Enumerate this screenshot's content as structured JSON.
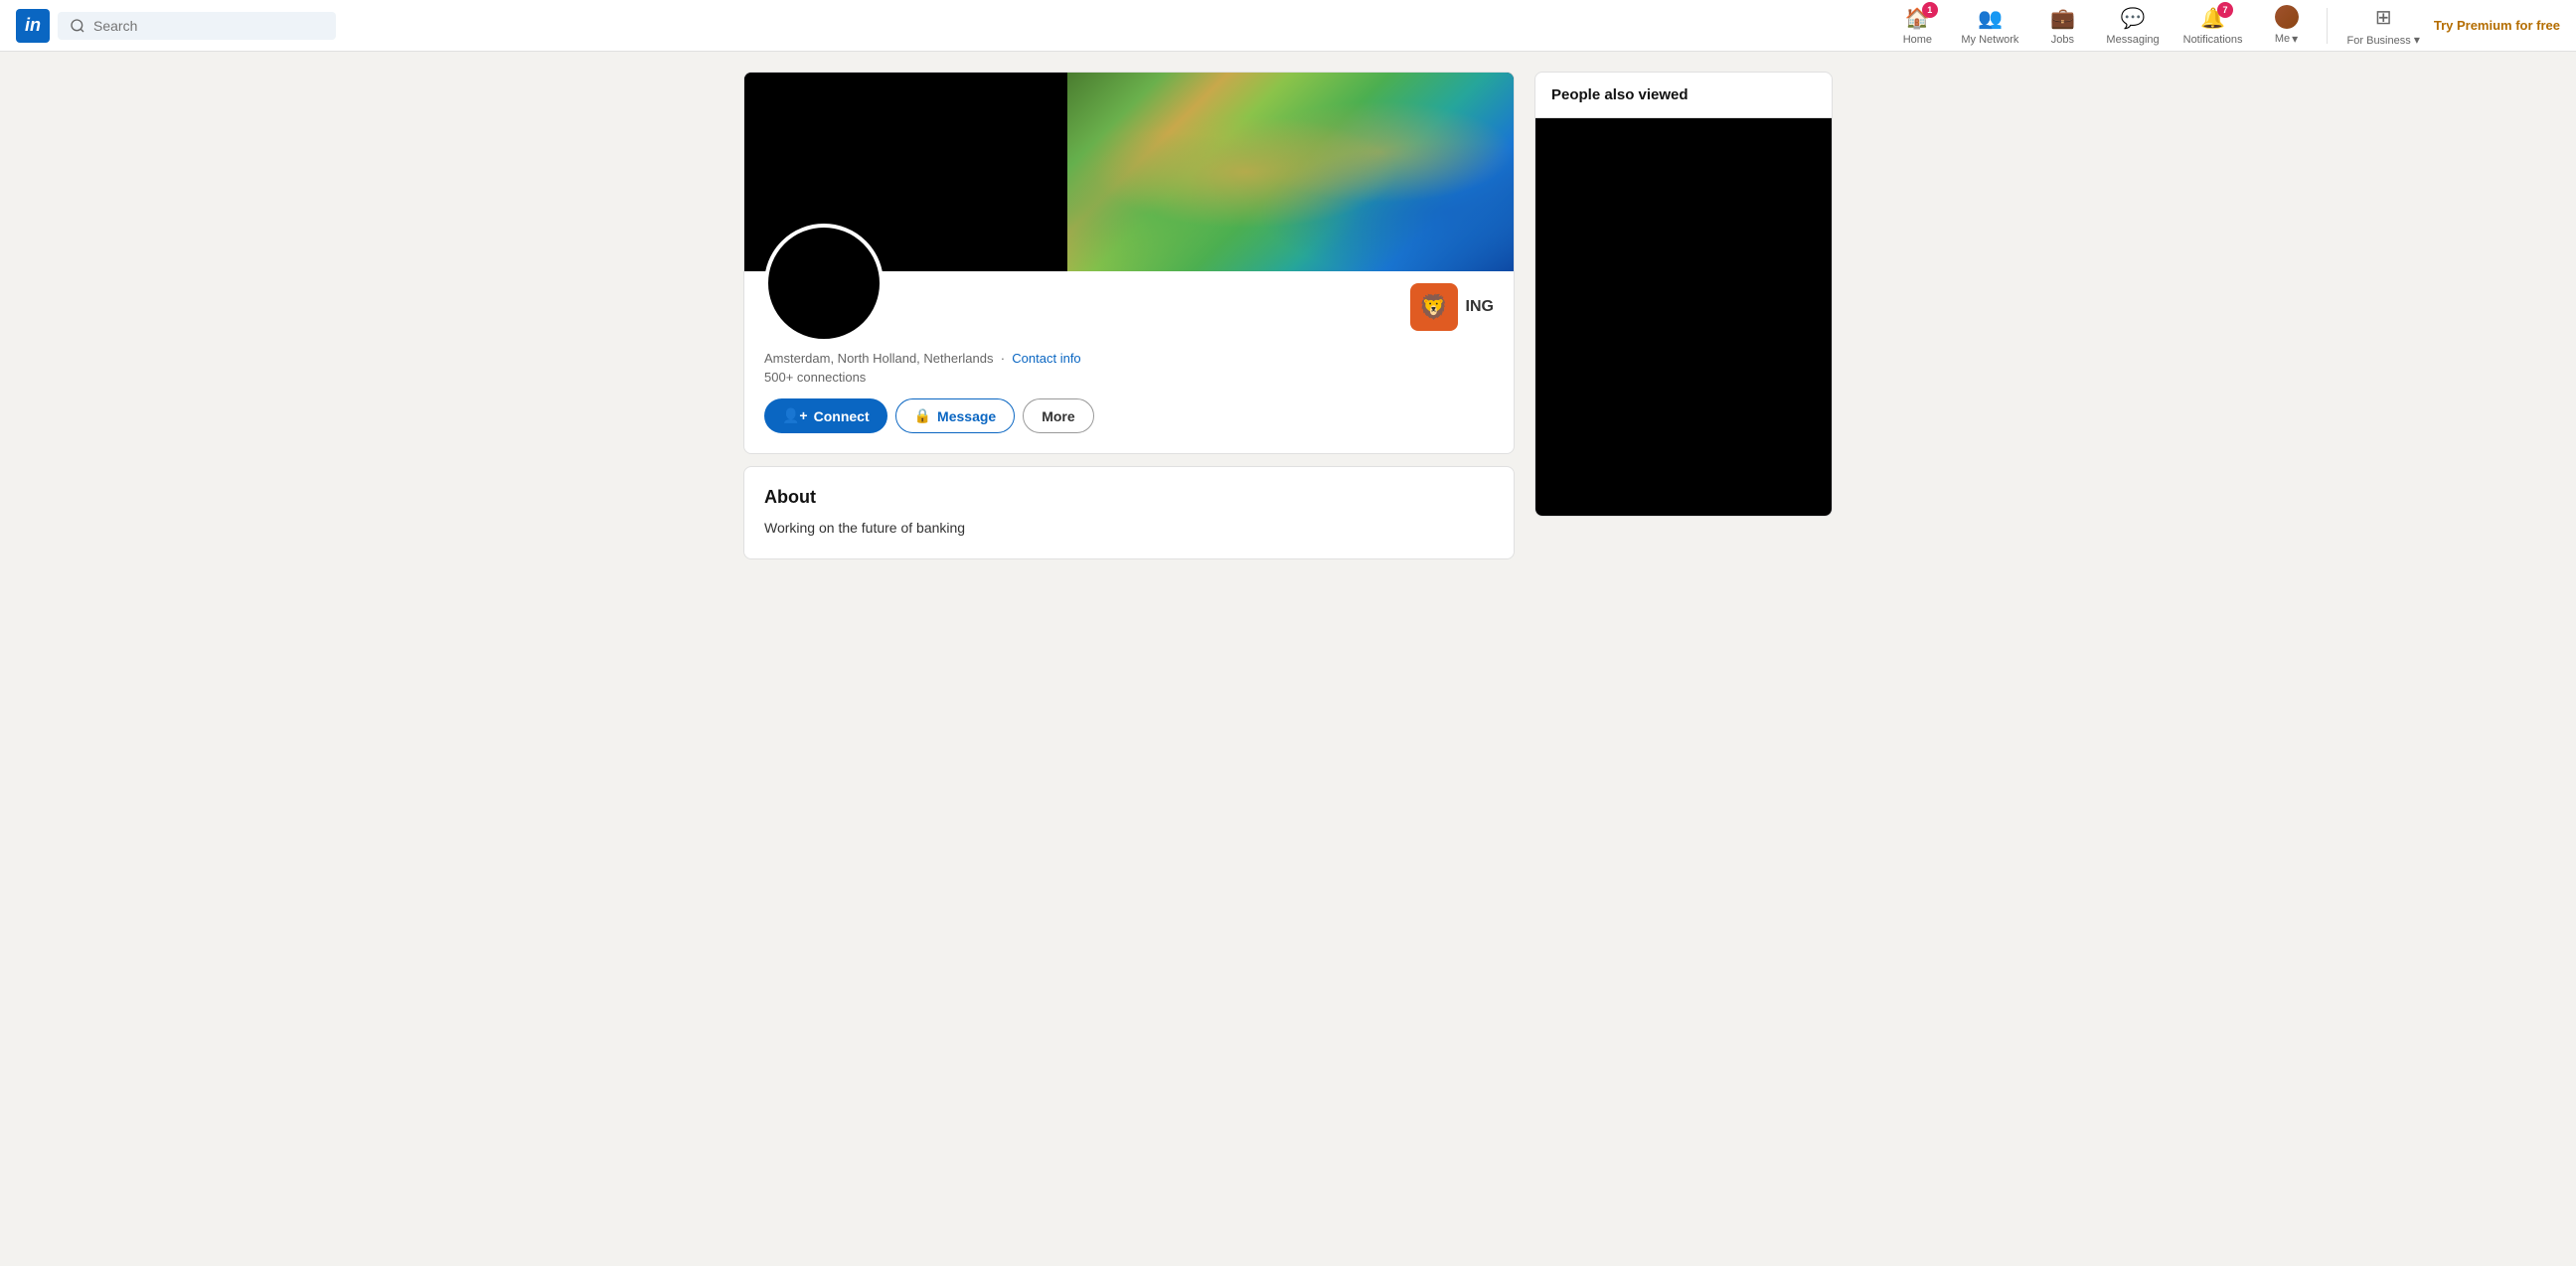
{
  "navbar": {
    "logo_text": "in",
    "search_placeholder": "Search",
    "nav_items": [
      {
        "id": "home",
        "label": "Home",
        "icon": "🏠",
        "badge": "1"
      },
      {
        "id": "my-network",
        "label": "My Network",
        "icon": "👥",
        "badge": null
      },
      {
        "id": "jobs",
        "label": "Jobs",
        "icon": "💼",
        "badge": null
      },
      {
        "id": "messaging",
        "label": "Messaging",
        "icon": "💬",
        "badge": null
      },
      {
        "id": "notifications",
        "label": "Notifications",
        "icon": "🔔",
        "badge": "7"
      }
    ],
    "me_label": "Me",
    "for_business_label": "For Business",
    "try_premium_label": "Try Premium for free"
  },
  "profile": {
    "location": "Amsterdam, North Holland, Netherlands",
    "contact_info_label": "Contact info",
    "connections": "500+",
    "connections_label": "connections",
    "company_name": "ING",
    "company_icon": "🦁",
    "btn_connect": "Connect",
    "btn_message": "Message",
    "btn_more": "More"
  },
  "about": {
    "title": "About",
    "text": "Working on the future of banking"
  },
  "sidebar": {
    "people_also_viewed_title": "People also viewed"
  }
}
